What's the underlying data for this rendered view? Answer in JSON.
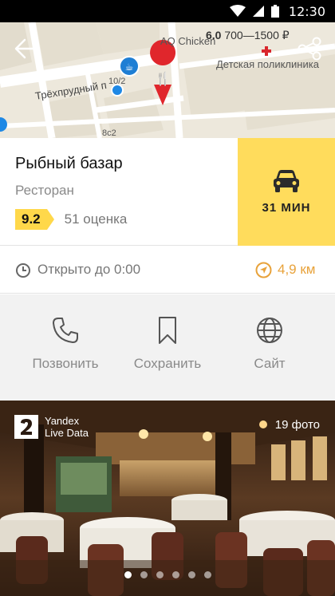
{
  "status_bar": {
    "time": "12:30"
  },
  "map": {
    "street_name": "Трёхпрудный п",
    "poi_label": "AQ Chicken",
    "clinic_label": "Детская поликлиника",
    "house_number_1": "10/2",
    "house_number_2": "8с2",
    "price": {
      "rating": "6.0",
      "range": "700—1500 ₽"
    }
  },
  "place": {
    "name": "Рыбный базар",
    "category": "Ресторан",
    "rating": "9.2",
    "rating_count": "51 оценка",
    "route_time": "31 МИН"
  },
  "hours": {
    "open_text": "Открыто до 0:00",
    "distance": "4,9 км"
  },
  "actions": [
    {
      "label": "Позвонить",
      "icon": "phone-icon"
    },
    {
      "label": "Сохранить",
      "icon": "bookmark-icon"
    },
    {
      "label": "Сайт",
      "icon": "globe-icon"
    }
  ],
  "photo": {
    "provider_line1": "Yandex",
    "provider_line2": "Live Data",
    "count": "19 фото",
    "active_dot": 0,
    "total_dots": 6
  },
  "colors": {
    "accent_yellow": "#ffdc5c",
    "distance_orange": "#e8a23a",
    "pin_red": "#e0262c"
  }
}
